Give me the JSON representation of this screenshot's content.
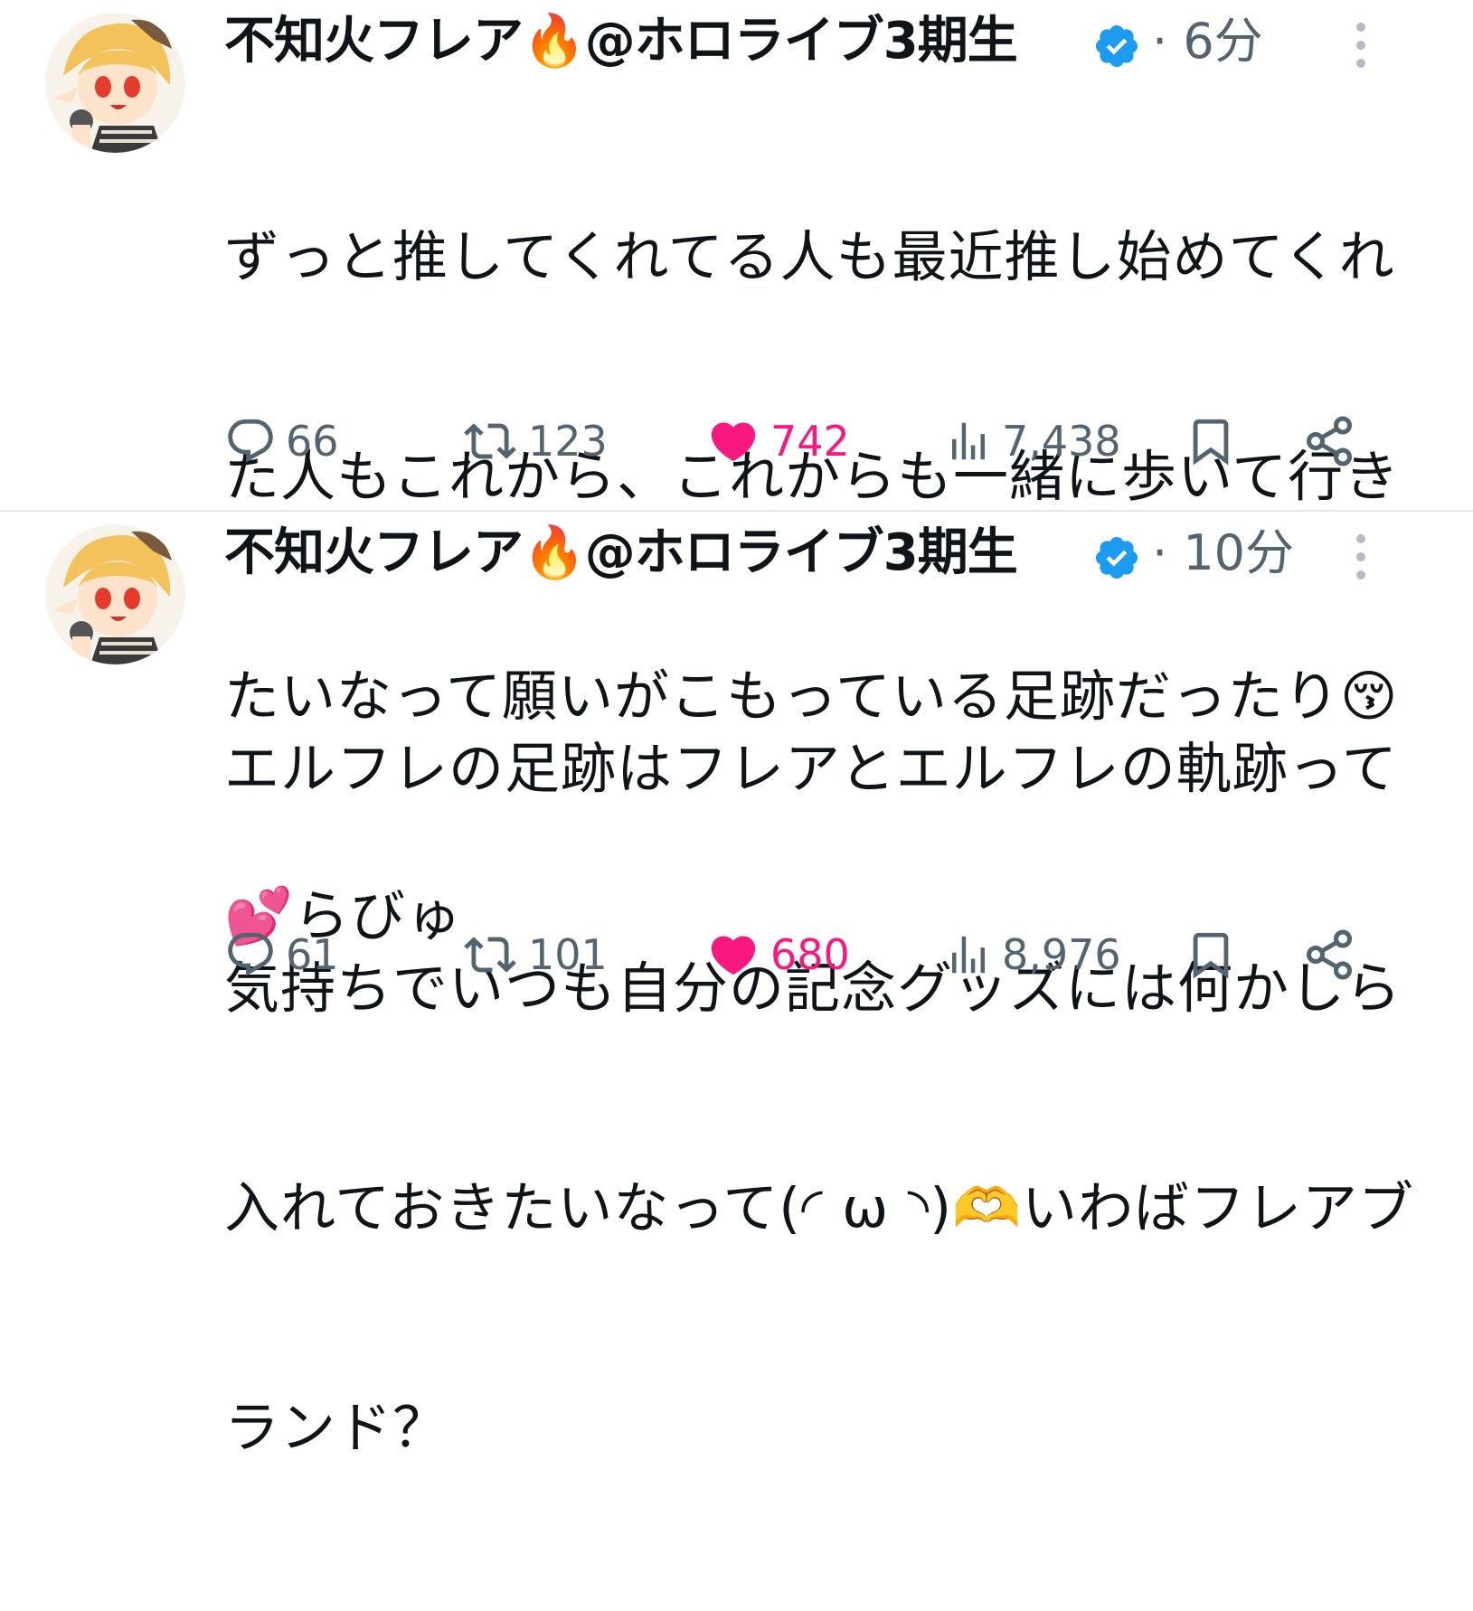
{
  "tweets": [
    {
      "author": {
        "display_name": "不知火フレア🔥@ホロライブ3期生",
        "verified_icon": "verified-badge-icon"
      },
      "time": "· 6分",
      "text": "ずっと推してくれてる人も最近推し始めてくれた人もこれから、これからも一緒に歩いて行きたいなって願いがこもっている足跡だったり😚💕らびゅ",
      "lines": [
        "ずっと推してくれてる人も最近推し始めてくれ",
        "た人もこれから、これからも一緒に歩いて行き",
        "たいなって願いがこもっている足跡だったり😚",
        "💕らびゅ"
      ],
      "actions": {
        "replies": "66",
        "reposts": "123",
        "likes": "742",
        "views": "7,438"
      }
    },
    {
      "author": {
        "display_name": "不知火フレア🔥@ホロライブ3期生",
        "verified_icon": "verified-badge-icon"
      },
      "time": "· 10分",
      "text": "エルフレの足跡はフレアとエルフレの軌跡って気持ちでいつも自分の記念グッズには何かしら入れておきたいなって(◜ ω ◝)🫶いわばフレアブランド？",
      "lines": [
        "エルフレの足跡はフレアとエルフレの軌跡って",
        "気持ちでいつも自分の記念グッズには何かしら",
        "入れておきたいなって(◜ ω ◝)🫶いわばフレアブ",
        "ランド？"
      ],
      "actions": {
        "replies": "61",
        "reposts": "101",
        "likes": "680",
        "views": "8,976"
      }
    }
  ],
  "colors": {
    "text": "#0f1419",
    "secondary": "#536471",
    "like_active": "#f91880",
    "verified": "#1d9bf0",
    "divider": "#e4e7ea"
  },
  "icons": [
    "reply-icon",
    "repost-icon",
    "like-icon",
    "views-icon",
    "bookmark-icon",
    "share-icon",
    "more-icon",
    "verified-badge-icon"
  ]
}
